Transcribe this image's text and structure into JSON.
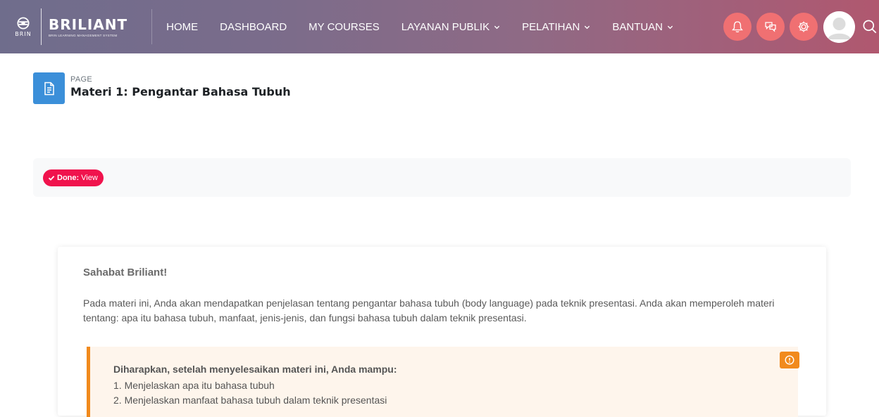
{
  "header": {
    "org_logo_text": "BRIN",
    "brand_name": "BRILIANT",
    "brand_tagline": "BRIN LEARNING MANAGEMENT SYSTEM",
    "nav": [
      {
        "label": "HOME",
        "has_dropdown": false
      },
      {
        "label": "DASHBOARD",
        "has_dropdown": false
      },
      {
        "label": "MY COURSES",
        "has_dropdown": false
      },
      {
        "label": "LAYANAN PUBLIK",
        "has_dropdown": true
      },
      {
        "label": "PELATIHAN",
        "has_dropdown": true
      },
      {
        "label": "BANTUAN",
        "has_dropdown": true
      }
    ],
    "action_icons": [
      "notification-bell-icon",
      "messages-icon",
      "settings-gear-icon"
    ],
    "accent_color": "#f07072"
  },
  "page": {
    "kind": "PAGE",
    "title": "Materi 1: Pengantar Bahasa Tubuh",
    "icon": "document-icon",
    "icon_color": "#3b8fd9"
  },
  "completion": {
    "status": "Done:",
    "condition": "View",
    "badge_color": "#f0134d"
  },
  "content": {
    "greeting": "Sahabat Briliant!",
    "intro": "Pada materi ini, Anda akan mendapatkan penjelasan tentang pengantar bahasa tubuh (body language) pada teknik presentasi. Anda akan memperoleh materi tentang: apa itu bahasa tubuh, manfaat, jenis-jenis, dan fungsi bahasa tubuh dalam teknik presentasi.",
    "callout": {
      "title": "Diharapkan, setelah menyelesaikan materi ini, Anda mampu:",
      "items": [
        "1. Menjelaskan apa itu bahasa tubuh",
        "2. Menjelaskan manfaat bahasa tubuh dalam teknik presentasi"
      ],
      "accent_color": "#f18a1d"
    }
  }
}
